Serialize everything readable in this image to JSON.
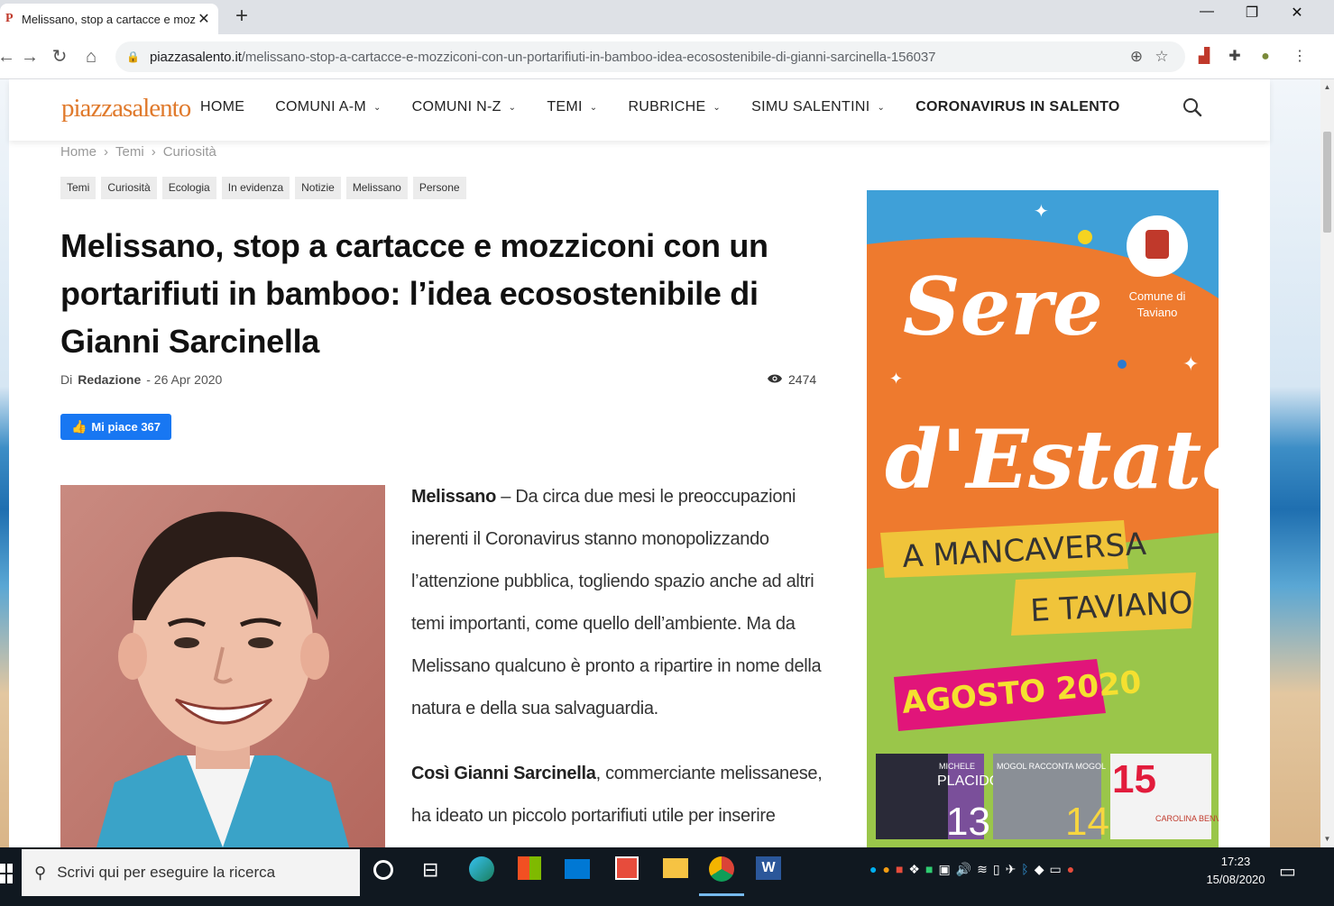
{
  "browser": {
    "tab_title": "Melissano, stop a cartacce e moz",
    "tab_favicon": "P",
    "url_domain": "piazzasalento.it",
    "url_path": "/melissano-stop-a-cartacce-e-mozziconi-con-un-portarifiuti-in-bamboo-idea-ecosostenibile-di-gianni-sarcinella-156037"
  },
  "site": {
    "logo_part1": "piazza",
    "logo_part2": "salento",
    "nav": [
      {
        "label": "HOME"
      },
      {
        "label": "COMUNI A-M"
      },
      {
        "label": "COMUNI N-Z"
      },
      {
        "label": "TEMI"
      },
      {
        "label": "RUBRICHE"
      },
      {
        "label": "SIMU SALENTINI"
      },
      {
        "label": "CORONAVIRUS IN SALENTO"
      }
    ]
  },
  "breadcrumb": [
    "Home",
    "›",
    "Temi",
    "›",
    "Curiosità"
  ],
  "tags": [
    "Temi",
    "Curiosità",
    "Ecologia",
    "In evidenza",
    "Notizie",
    "Melissano",
    "Persone"
  ],
  "article": {
    "title": "Melissano, stop a cartacce e mozziconi con un portarifiuti in bamboo: l’idea ecosostenibile di Gianni Sarcinella",
    "by": "Di",
    "author": "Redazione",
    "date": "- 26 Apr 2020",
    "views": "2474",
    "like_label": "Mi piace 367",
    "p1_lead": "Melissano",
    "p1_text": " – Da circa due mesi le preoccupazioni inerenti il Coronavirus stanno monopolizzando l’attenzione pubblica, togliendo spazio anche ad altri temi importanti, come quello dell’ambiente. Ma da Melissano qualcuno è pronto a ripartire in nome della natura e della sua salvaguardia.",
    "p2_lead": "Così Gianni Sarcinella",
    "p2_text": ", commerciante melissanese, ha ideato un piccolo portarifiuti utile per inserire"
  },
  "ad": {
    "line1": "Sere",
    "line2": "d'Estate",
    "line3": "A MANCAVERSA",
    "line4": "E TAVIANO",
    "line5": "AGOSTO 2020",
    "comune": "Comune di",
    "comune2": "Taviano",
    "tile1_name": "PLACIDO",
    "tile1_top": "MICHELE",
    "tile1_num": "13",
    "tile2_name": "MOGOL RACCONTA MOGOL",
    "tile2_num": "14",
    "tile3_num": "15",
    "tile3_name": "CAROLINA BENVENGA"
  },
  "taskbar": {
    "search_placeholder": "Scrivi qui per eseguire la ricerca",
    "time": "17:23",
    "date": "15/08/2020"
  }
}
